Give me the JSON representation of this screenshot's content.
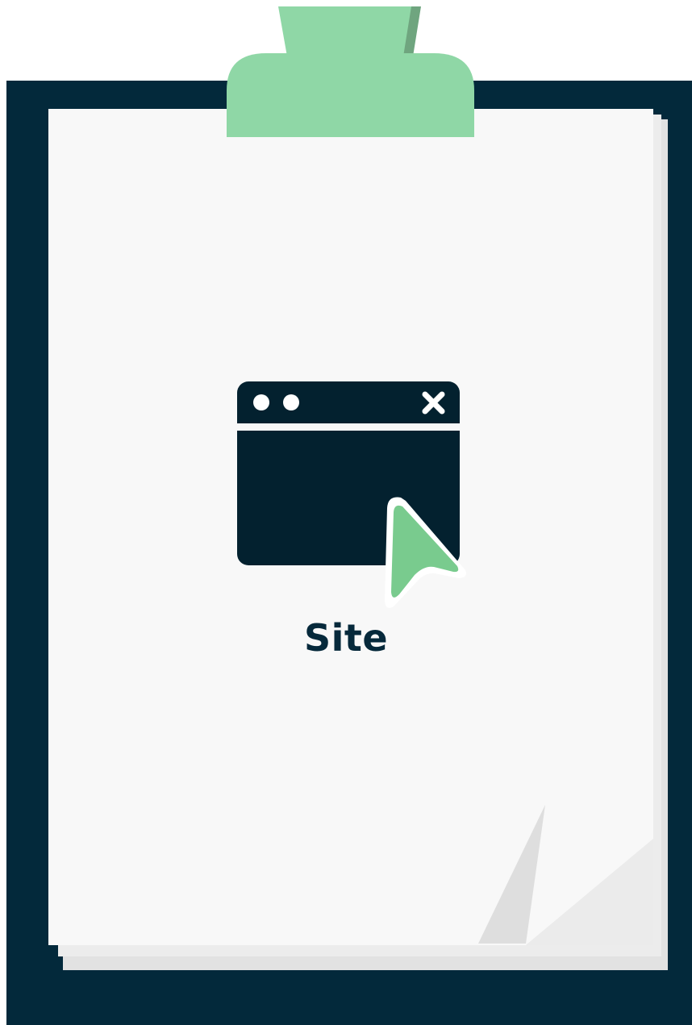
{
  "label": "Site",
  "icon": "browser-window-cursor-icon",
  "colors": {
    "board": "#03293b",
    "clip": "#8fd7a6",
    "clip_shadow": "#6fa57f",
    "paper": "#f8f8f8",
    "paper_under": "#e4e4e4",
    "icon_dark": "#03212f",
    "cursor": "#79cb8e",
    "text": "#06293b"
  }
}
